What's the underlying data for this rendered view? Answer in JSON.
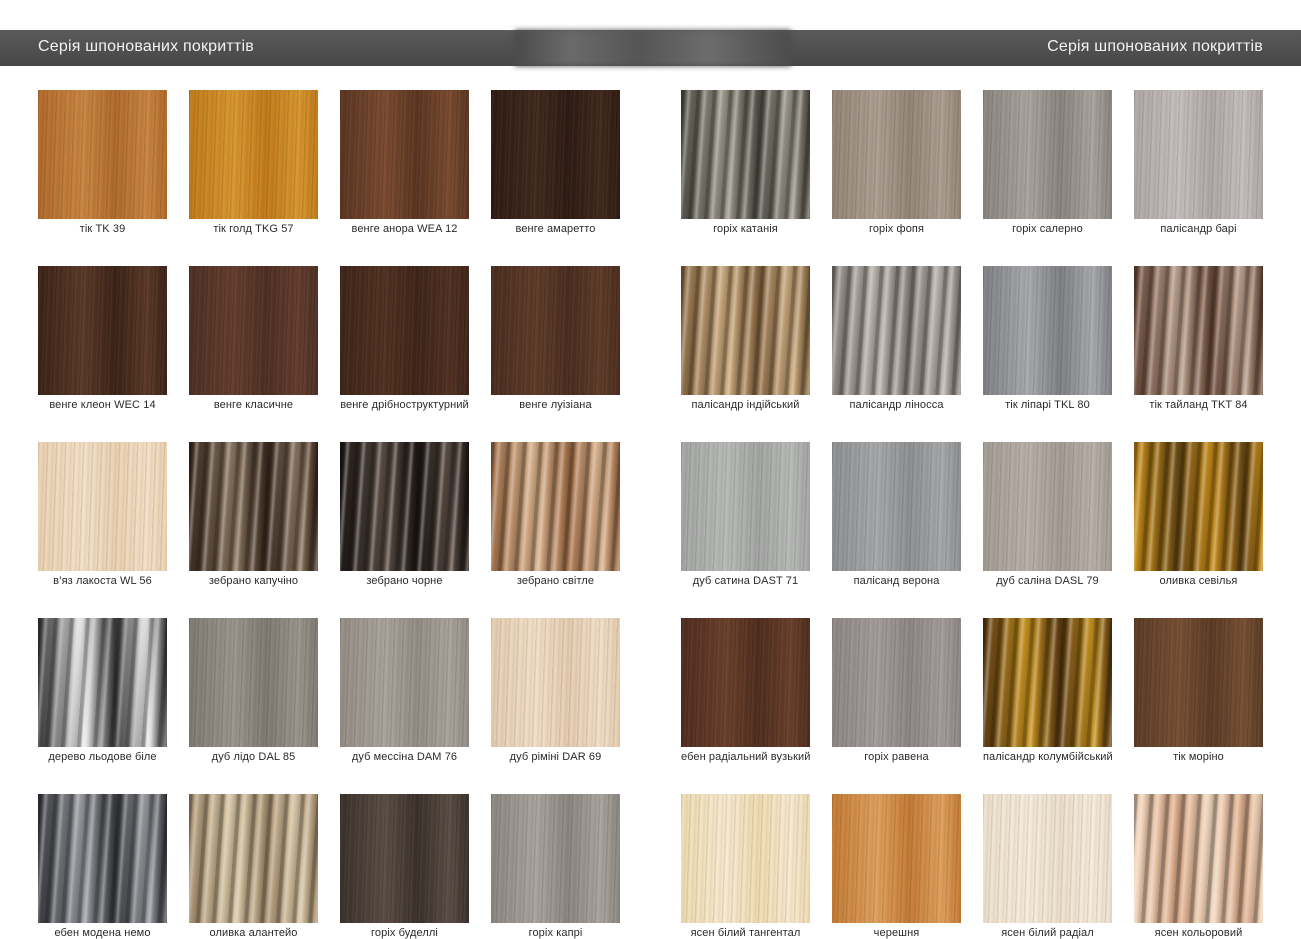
{
  "header": {
    "left_title": "Серія шпонованих покриттів",
    "right_title": "Серія шпонованих покриттів"
  },
  "left_page": {
    "swatches": [
      {
        "label": "тік TK 39",
        "color": "#b06a2a",
        "color2": "#c98440",
        "pattern": "grain"
      },
      {
        "label": "тік голд TKG 57",
        "color": "#c27a18",
        "color2": "#d8962e",
        "pattern": "grain"
      },
      {
        "label": "венге анора WEA 12",
        "color": "#5a3420",
        "color2": "#7a4a2e",
        "pattern": "grain"
      },
      {
        "label": "венге амаретто",
        "color": "#2e1a12",
        "color2": "#40281c",
        "pattern": "grain"
      },
      {
        "label": "венге клеон WEC 14",
        "color": "#3a2216",
        "color2": "#5a3826",
        "pattern": "grain"
      },
      {
        "label": "венге класичне",
        "color": "#4e2e22",
        "color2": "#623c2c",
        "pattern": "grain"
      },
      {
        "label": "венге дрібноструктурний",
        "color": "#3e2418",
        "color2": "#503020",
        "pattern": "grain"
      },
      {
        "label": "венге луізіана",
        "color": "#4a2c1e",
        "color2": "#5e3a28",
        "pattern": "grain"
      },
      {
        "label": "в’яз лакоста WL 56",
        "color": "#ecd2b2",
        "color2": "#f4e0c6",
        "pattern": "grain"
      },
      {
        "label": "зебрано капучіно",
        "color": "#3c2a20",
        "color2": "#8a7660",
        "pattern": "stripe"
      },
      {
        "label": "зебрано чорне",
        "color": "#1e1816",
        "color2": "#5a4c44",
        "pattern": "stripe"
      },
      {
        "label": "зебрано світле",
        "color": "#a06e48",
        "color2": "#d6b08a",
        "pattern": "stripe"
      },
      {
        "label": "дерево льодове біле",
        "color": "#3a3a3a",
        "color2": "#eeeeee",
        "pattern": "stripe"
      },
      {
        "label": "дуб лідо DAL 85",
        "color": "#7e7a72",
        "color2": "#9a958c",
        "pattern": "grain"
      },
      {
        "label": "дуб мессіна DAM 76",
        "color": "#948d86",
        "color2": "#aaa39c",
        "pattern": "grain"
      },
      {
        "label": "дуб ріміні DAR 69",
        "color": "#e6cdb0",
        "color2": "#f2dfc8",
        "pattern": "grain"
      },
      {
        "label": "ебен модена немо",
        "color": "#3a3c40",
        "color2": "#9a9ca2",
        "pattern": "stripe"
      },
      {
        "label": "оливка алантейо",
        "color": "#a89070",
        "color2": "#d6c4a4",
        "pattern": "stripe"
      },
      {
        "label": "горіх буделлі",
        "color": "#3a302a",
        "color2": "#5a4c44",
        "pattern": "grain"
      },
      {
        "label": "горіх капрі",
        "color": "#8c8680",
        "color2": "#aaa49e",
        "pattern": "grain"
      }
    ]
  },
  "right_page": {
    "swatches": [
      {
        "label": "горіх катанія",
        "color": "#55524a",
        "color2": "#9a968a",
        "pattern": "stripe"
      },
      {
        "label": "горіх фопя",
        "color": "#948476",
        "color2": "#ac9e90",
        "pattern": "grain"
      },
      {
        "label": "горіх салерно",
        "color": "#8a847e",
        "color2": "#aaa49e",
        "pattern": "grain"
      },
      {
        "label": "палісандр барі",
        "color": "#b0a8a6",
        "color2": "#c4bebc",
        "pattern": "grain"
      },
      {
        "label": "палісандр індійський",
        "color": "#8a6a44",
        "color2": "#c8a87c",
        "pattern": "stripe"
      },
      {
        "label": "палісандр ліносса",
        "color": "#8a8480",
        "color2": "#b6b0aa",
        "pattern": "stripe"
      },
      {
        "label": "тік ліпарі TKL 80",
        "color": "#7e8084",
        "color2": "#a8aaae",
        "pattern": "grain"
      },
      {
        "label": "тік тайланд TKT 84",
        "color": "#6a4a38",
        "color2": "#b89e8a",
        "pattern": "stripe"
      },
      {
        "label": "дуб сатина DAST 71",
        "color": "#a4a6a4",
        "color2": "#b8bab8",
        "pattern": "grain"
      },
      {
        "label": "палісанд верона",
        "color": "#8e9092",
        "color2": "#a6a8aa",
        "pattern": "grain"
      },
      {
        "label": "дуб саліна DASL 79",
        "color": "#a49c94",
        "color2": "#b8b0a8",
        "pattern": "grain"
      },
      {
        "label": "оливка севілья",
        "color": "#c48a18",
        "color2": "#6a4a14",
        "pattern": "stripe"
      },
      {
        "label": "ебен радіальний вузький",
        "color": "#4e2c1e",
        "color2": "#6a3e2a",
        "pattern": "grain"
      },
      {
        "label": "горіх равена",
        "color": "#8e8684",
        "color2": "#a49c9a",
        "pattern": "grain"
      },
      {
        "label": "палісандр колумбійський",
        "color": "#5a3a12",
        "color2": "#c8941e",
        "pattern": "stripe"
      },
      {
        "label": "тік моріно",
        "color": "#5a3a24",
        "color2": "#764e32",
        "pattern": "grain"
      },
      {
        "label": "ясен білий тангентал",
        "color": "#f0dcb2",
        "color2": "#f8ead0",
        "pattern": "grain"
      },
      {
        "label": "черешня",
        "color": "#c47a34",
        "color2": "#e0a05c",
        "pattern": "grain"
      },
      {
        "label": "ясен білий радіал",
        "color": "#eee0cc",
        "color2": "#f6ecdc",
        "pattern": "grain"
      },
      {
        "label": "ясен кольоровий",
        "color": "#f0d6bc",
        "color2": "#d8a888",
        "pattern": "stripe"
      }
    ]
  }
}
